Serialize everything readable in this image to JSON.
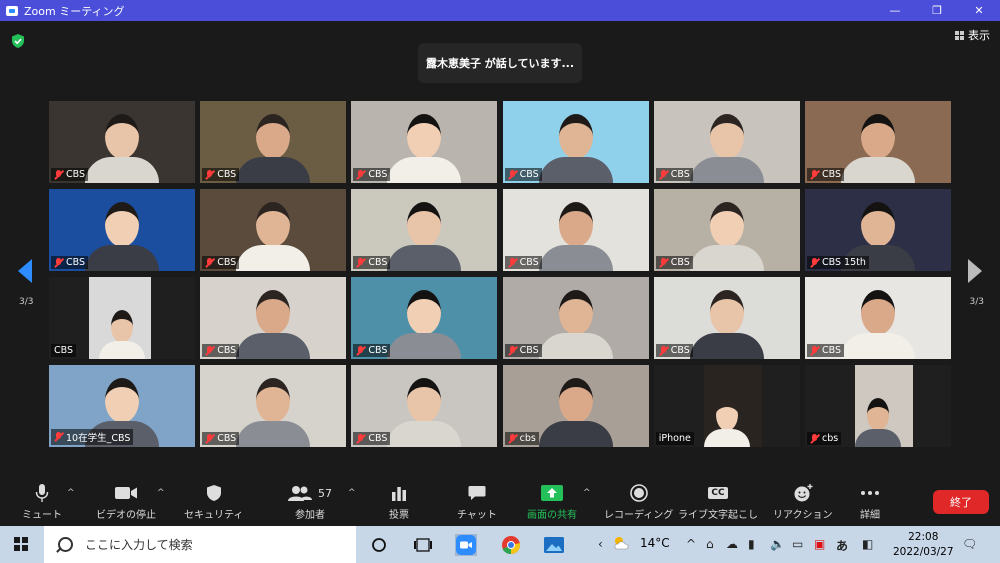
{
  "window": {
    "title": "Zoom ミーティング",
    "min": "—",
    "max": "❐",
    "close": "✕"
  },
  "meeting": {
    "speaker_banner": "露木恵美子 が話しています...",
    "view_label": "表示",
    "page_left": "3/3",
    "page_right": "3/3"
  },
  "tiles": [
    {
      "label": "CBS",
      "bg": "#3a3530",
      "muted": true
    },
    {
      "label": "CBS",
      "bg": "#6b5d44",
      "muted": true
    },
    {
      "label": "CBS",
      "bg": "#b9b4ad",
      "muted": true
    },
    {
      "label": "CBS",
      "bg": "#8fd0ea",
      "muted": true
    },
    {
      "label": "CBS",
      "bg": "#c8c3bd",
      "muted": true
    },
    {
      "label": "CBS",
      "bg": "#8a6a52",
      "muted": true
    },
    {
      "label": "CBS",
      "bg": "#1c4ea0",
      "muted": true
    },
    {
      "label": "CBS",
      "bg": "#5a4b3c",
      "muted": true
    },
    {
      "label": "CBS",
      "bg": "#cbc8bd",
      "muted": true
    },
    {
      "label": "CBS",
      "bg": "#e4e2dc",
      "muted": true
    },
    {
      "label": "CBS",
      "bg": "#b7b0a4",
      "muted": true
    },
    {
      "label": "CBS 15th",
      "bg": "#2c2f45",
      "muted": true
    },
    {
      "label": "CBS",
      "bg": "#d9d9d9",
      "muted": false
    },
    {
      "label": "CBS",
      "bg": "#d7d3cc",
      "muted": true
    },
    {
      "label": "CBS",
      "bg": "#4d90a8",
      "muted": true
    },
    {
      "label": "CBS",
      "bg": "#b0aba6",
      "muted": true
    },
    {
      "label": "CBS",
      "bg": "#dcdcd8",
      "muted": true
    },
    {
      "label": "CBS",
      "bg": "#e8e6e3",
      "muted": true
    },
    {
      "label": "10在学生_CBS",
      "bg": "#7fa4c8",
      "muted": true
    },
    {
      "label": "CBS",
      "bg": "#d6d2cc",
      "muted": true
    },
    {
      "label": "CBS",
      "bg": "#c9c5c0",
      "muted": true
    },
    {
      "label": "cbs",
      "bg": "#a89f96",
      "muted": true
    },
    {
      "label": "iPhone",
      "bg": "#2a2420",
      "muted": false
    },
    {
      "label": "cbs",
      "bg": "#cfc8c0",
      "muted": true
    }
  ],
  "toolbar": {
    "mute": "ミュート",
    "video": "ビデオの停止",
    "security": "セキュリティ",
    "participants": "参加者",
    "participants_count": "57",
    "poll": "投票",
    "chat": "チャット",
    "share": "画面の共有",
    "record": "レコーディング",
    "captions": "ライブ文字起こし",
    "reactions": "リアクション",
    "more": "詳細",
    "end": "終了",
    "cc": "CC"
  },
  "taskbar": {
    "search_placeholder": "ここに入力して検索",
    "temperature": "14°C",
    "time": "22:08",
    "date": "2022/03/27",
    "ime": "あ"
  },
  "colors": {
    "accent": "#2d8cff",
    "titlebar": "#4a4ed8",
    "end": "#e02828",
    "share": "#24c15a",
    "mute": "#ff3b3b"
  }
}
